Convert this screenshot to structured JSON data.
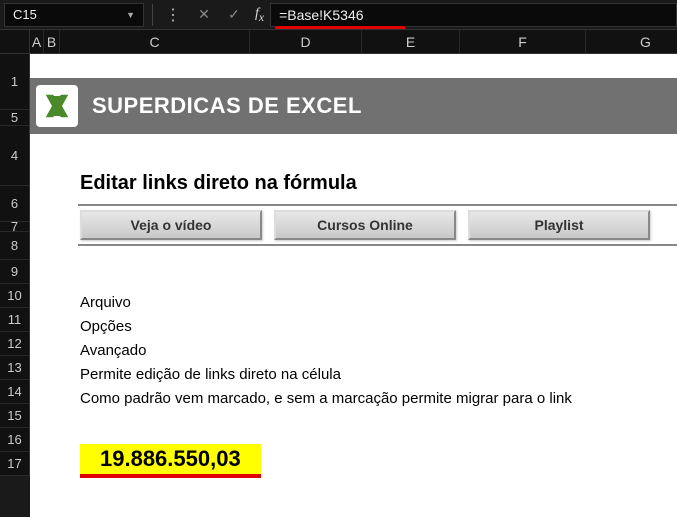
{
  "formula_bar": {
    "cell_ref": "C15",
    "formula": "=Base!K5346"
  },
  "columns": [
    "A",
    "B",
    "C",
    "D",
    "E",
    "F",
    "G"
  ],
  "rows": [
    "1",
    "5",
    "4",
    "6",
    "7",
    "8",
    "9",
    "10",
    "11",
    "12",
    "13",
    "14",
    "15",
    "16",
    "17"
  ],
  "banner": {
    "title": "SUPERDICAS DE EXCEL"
  },
  "subtitle": "Editar links direto na fórmula",
  "buttons": {
    "b1": "Veja o vídeo",
    "b2": "Cursos Online",
    "b3": "Playlist"
  },
  "lines": {
    "l1": "Arquivo",
    "l2": "Opções",
    "l3": "Avançado",
    "l4": "Permite edição de links direto na célula",
    "l5": "Como padrão vem marcado, e sem a marcação permite migrar para o link"
  },
  "highlighted_value": "19.886.550,03"
}
